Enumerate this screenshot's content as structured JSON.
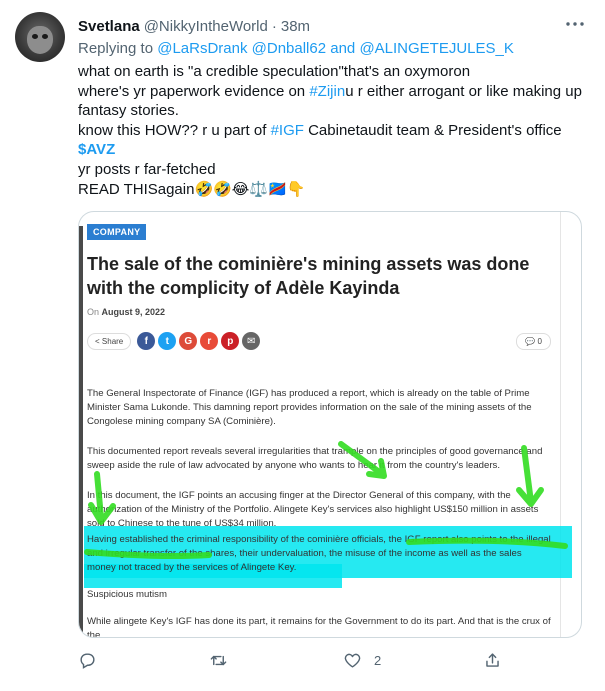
{
  "tweet": {
    "name": "Svetlana",
    "handle": "@NikkyIntheWorld",
    "dot": "·",
    "time": "38m",
    "reply_prefix": "Replying to ",
    "reply_to": "@LaRsDrank @Dnball62 and @ALINGETEJULES_K",
    "lines": {
      "l1": "what on earth is \"a credible speculation\"that's an oxymoron",
      "l2a": "where's yr paperwork evidence on ",
      "l2_tag": "#Zijin",
      "l2b": "u r either arrogant or like making up",
      "l3": "fantasy stories.",
      "l4a": "know this HOW?? r u part of ",
      "l4_tag": "#IGF",
      "l4b": " Cabinetaudit team & President's office",
      "l5_cash": "$AVZ",
      "l6": "yr posts r far-fetched",
      "l7": "READ THISagain🤣🤣😂⚖️🇨🇩👇"
    }
  },
  "article": {
    "category": "COMPANY",
    "title": "The sale of the cominière's mining assets was done with the complicity of Adèle Kayinda",
    "date_prefix": "On ",
    "date": "August 9, 2022",
    "share_label": "Share",
    "comment_count": "0",
    "p1": "The General Inspectorate of Finance (IGF) has produced a report, which is already on the table of Prime Minister Sama Lukonde. This damning report provides information on the sale of the mining assets of the Congolese mining company SA (Cominière).",
    "p2": "This documented report reveals several irregularities that trample on the principles of good governance and sweep aside the rule of law advocated by anyone who wants to hear it from the country's leaders.",
    "p3": "In this document, the IGF points an accusing finger at the Director General of this company, with the authorization of the Ministry of the Portfolio. Alingete Key's services also highlight US$150 million in assets sold to Chinese to the tune of US$34 million.",
    "p4": "Having established the criminal responsibility of the cominière officials, the IGF report also points to the illegal and irregular transfer of the shares, their undervaluation, the misuse of the income as well as the sales money not traced by the services of Alingete Key.",
    "p5": "Suspicious mutism",
    "p6": "While alingete Key's IGF has done its part, it remains for the Government to do its part. And that is the crux of the"
  },
  "actions": {
    "reply_count": "",
    "retweet_count": "",
    "like_count": "2",
    "share_count": ""
  },
  "icons": {
    "more": "more-dots-icon",
    "reply": "reply-bubble-icon",
    "retweet": "retweet-icon",
    "like": "heart-icon",
    "share": "share-upload-icon"
  },
  "colors": {
    "link": "#1d9bf0",
    "muted": "#536471",
    "highlight": "#00e5ee",
    "marker": "#33dd22",
    "badge": "#2b7ed1"
  }
}
